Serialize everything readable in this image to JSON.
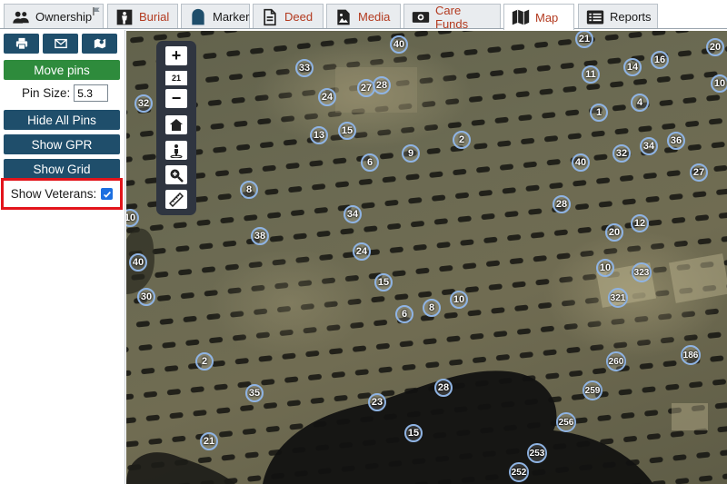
{
  "tabs": [
    {
      "label": "Ownership",
      "icon": "users-icon",
      "active": false,
      "red": false
    },
    {
      "label": "Burial",
      "icon": "person-icon",
      "active": false,
      "red": true
    },
    {
      "label": "Marker",
      "icon": "gravestone-icon",
      "active": false,
      "red": false
    },
    {
      "label": "Deed",
      "icon": "document-icon",
      "active": false,
      "red": true
    },
    {
      "label": "Media",
      "icon": "image-icon",
      "active": false,
      "red": true
    },
    {
      "label": "Care Funds",
      "icon": "money-icon",
      "active": false,
      "red": true
    },
    {
      "label": "Map",
      "icon": "map-icon",
      "active": true,
      "red": true
    },
    {
      "label": "Reports",
      "icon": "list-icon",
      "active": false,
      "red": false
    }
  ],
  "sidebar": {
    "move_pins": "Move pins",
    "pin_size_label": "Pin Size:",
    "pin_size_value": "5.3",
    "hide_all_pins": "Hide All Pins",
    "show_gpr": "Show GPR",
    "show_grid": "Show Grid",
    "show_veterans": "Show Veterans:",
    "show_veterans_checked": true
  },
  "map": {
    "zoom_level": "21",
    "zoom_in": "+",
    "zoom_out": "−",
    "pins": [
      "40",
      "21",
      "20",
      "33",
      "27",
      "28",
      "11",
      "14",
      "16",
      "10",
      "32",
      "24",
      "1",
      "4",
      "13",
      "15",
      "2",
      "32",
      "34",
      "36",
      "9",
      "6",
      "40",
      "27",
      "8",
      "10",
      "28",
      "34",
      "20",
      "12",
      "38",
      "24",
      "40",
      "15",
      "10",
      "323",
      "30",
      "6",
      "8",
      "10",
      "321",
      "2",
      "260",
      "186",
      "35",
      "28",
      "259",
      "23",
      "256",
      "15",
      "21",
      "253",
      "252"
    ]
  },
  "colors": {
    "primary": "#1f4e6b",
    "success": "#2e8b3c",
    "highlight": "#e3141b",
    "tab_active_text": "#b33a1f",
    "pin_border": "#8fb4e4"
  }
}
